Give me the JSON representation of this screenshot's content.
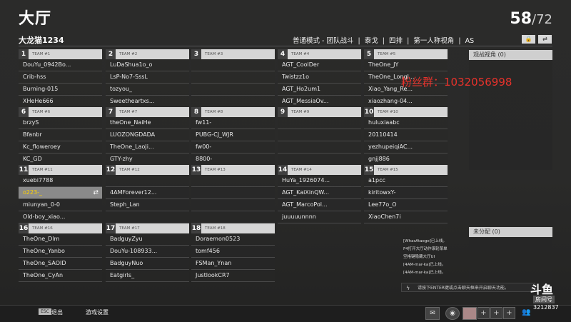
{
  "header": {
    "title": "大厅",
    "count": "58",
    "max": "/72",
    "username": "大龙猫1234",
    "mode": "普通模式 - 团队战斗  |  泰戈  |  四排  |  第一人称视角  |  AS"
  },
  "teams": [
    {
      "num": "1",
      "name": "TEAM #1",
      "players": [
        "DouYu_0942Bo...",
        "Crib-hss",
        "Burning-015",
        "XHeHe666"
      ]
    },
    {
      "num": "2",
      "name": "TEAM #2",
      "players": [
        "LuDaShua1o_o",
        "LsP-No7-SssL",
        "tozyou_",
        "Sweetheartxs..."
      ]
    },
    {
      "num": "3",
      "name": "TEAM #3",
      "players": [
        "",
        "",
        "",
        ""
      ]
    },
    {
      "num": "4",
      "name": "TEAM #4",
      "players": [
        "AGT_CoolDer",
        "Twistzz1o",
        "AGT_Ho2um1",
        "AGT_MessiaOv..."
      ]
    },
    {
      "num": "5",
      "name": "TEAM #5",
      "players": [
        "TheOne_JY",
        "TheOne_LongI...",
        "Xiao_Yang_Re...",
        "xiaozhang-04..."
      ]
    },
    {
      "num": "6",
      "name": "TEAM #6",
      "players": [
        "brzyS",
        "Bfanbr",
        "Kc_floweroey",
        "KC_GD"
      ]
    },
    {
      "num": "7",
      "name": "TEAM #7",
      "players": [
        "theOne_NaiHe",
        "LUOZONGDADA",
        "TheOne_LaoJi...",
        "GTY-zhy"
      ]
    },
    {
      "num": "8",
      "name": "TEAM #8",
      "players": [
        "fw11-",
        "PUBG-CJ_WJR",
        "fw00-",
        "8800-"
      ]
    },
    {
      "num": "9",
      "name": "TEAM #9",
      "players": [
        "",
        "",
        "",
        ""
      ]
    },
    {
      "num": "10",
      "name": "TEAM #10",
      "players": [
        "huluxiaabc",
        "20110414",
        "yezhupeiqiAC...",
        "gnjj886"
      ]
    },
    {
      "num": "11",
      "name": "TEAM #11",
      "players": [
        "xuebi7788",
        "o223-_",
        "miunyan_0-0",
        "Old-boy_xiao..."
      ]
    },
    {
      "num": "12",
      "name": "TEAM #12",
      "players": [
        "",
        "4AMForever12...",
        "Steph_Lan",
        ""
      ]
    },
    {
      "num": "13",
      "name": "TEAM #13",
      "players": [
        "",
        "",
        "",
        ""
      ]
    },
    {
      "num": "14",
      "name": "TEAM #14",
      "players": [
        "HuYa_1926074...",
        "AGT_KaiXinQW...",
        "AGT_MarcoPol...",
        "juuuuunnnn"
      ]
    },
    {
      "num": "15",
      "name": "TEAM #15",
      "players": [
        "a1pcc",
        "kiritowxY-",
        "Lee77o_O",
        "XiaoChen7i"
      ]
    },
    {
      "num": "16",
      "name": "TEAM #16",
      "players": [
        "TheOne_Dlm",
        "TheOne_Yanbo",
        "TheOne_SAOID",
        "TheOne_CyAn"
      ]
    },
    {
      "num": "17",
      "name": "TEAM #17",
      "players": [
        "BadguyZyu",
        "DouYu-108933...",
        "BadguyNuo",
        "Eatgirls_"
      ]
    },
    {
      "num": "18",
      "name": "TEAM #18",
      "players": [
        "Doraemon0523",
        "tomf456",
        "FSMan_Ynan",
        "JustlookCR7"
      ]
    }
  ],
  "side": {
    "spectator": "观战视角 (0)",
    "unassigned": "未分配 (0)"
  },
  "fans": "粉丝群：1032056998",
  "chat": {
    "lines": [
      "[WhasAtaege]已上线。",
      "F4打开大厅动作滚轮菜单",
      "空格键隐藏大厅UI",
      "[4AM-mar-ka]已上线。",
      "[4AM-mar-ka]已上线。"
    ],
    "hint": "请按下ENTER键或点击聊天框来开启聊天功能。"
  },
  "bottom": {
    "esc": "ESC",
    "exit": "退出",
    "settings": "游戏设置"
  },
  "stream": {
    "logo": "斗鱼",
    "sub": "房间号",
    "room": "3212837"
  }
}
